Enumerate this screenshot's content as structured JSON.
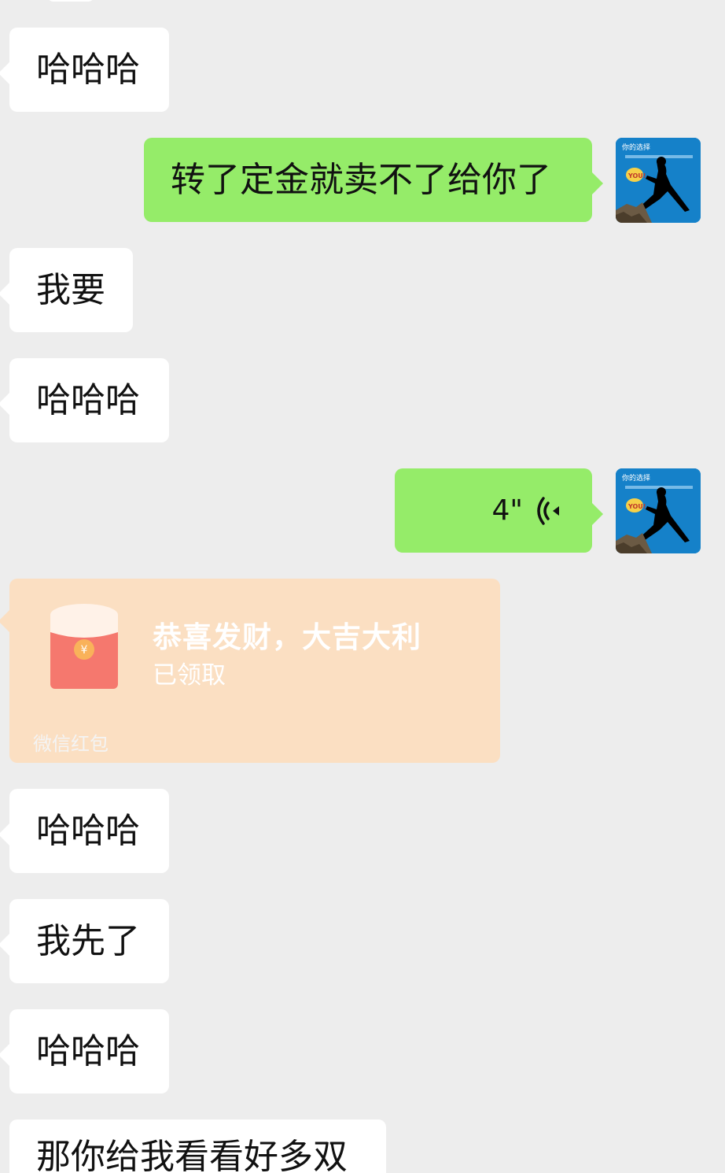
{
  "messages": [
    {
      "side": "in",
      "text": "哈哈哈"
    },
    {
      "side": "out",
      "text": "转了定金就卖不了给你了"
    },
    {
      "side": "in",
      "text": "我要"
    },
    {
      "side": "in",
      "text": "哈哈哈"
    },
    {
      "side": "out",
      "type": "voice",
      "duration": "4\""
    },
    {
      "side": "in",
      "type": "red_packet",
      "title": "恭喜发财，大吉大利",
      "status": "已领取",
      "footer": "微信红包"
    },
    {
      "side": "in",
      "text": "哈哈哈"
    },
    {
      "side": "in",
      "text": "我先了"
    },
    {
      "side": "in",
      "text": "哈哈哈"
    },
    {
      "side": "in",
      "text": "那你给我看看好多双"
    }
  ],
  "avatar": {
    "text_top": "你的选择",
    "text_badge": "YOU!"
  },
  "colors": {
    "background": "#ededed",
    "incoming_bubble": "#ffffff",
    "outgoing_bubble": "#95ec69",
    "red_packet_bubble": "#fbdfc2",
    "red_packet_icon": "#f5786e"
  },
  "icons": {
    "voice": "voice-wave-icon",
    "red_packet": "red-envelope-icon"
  }
}
